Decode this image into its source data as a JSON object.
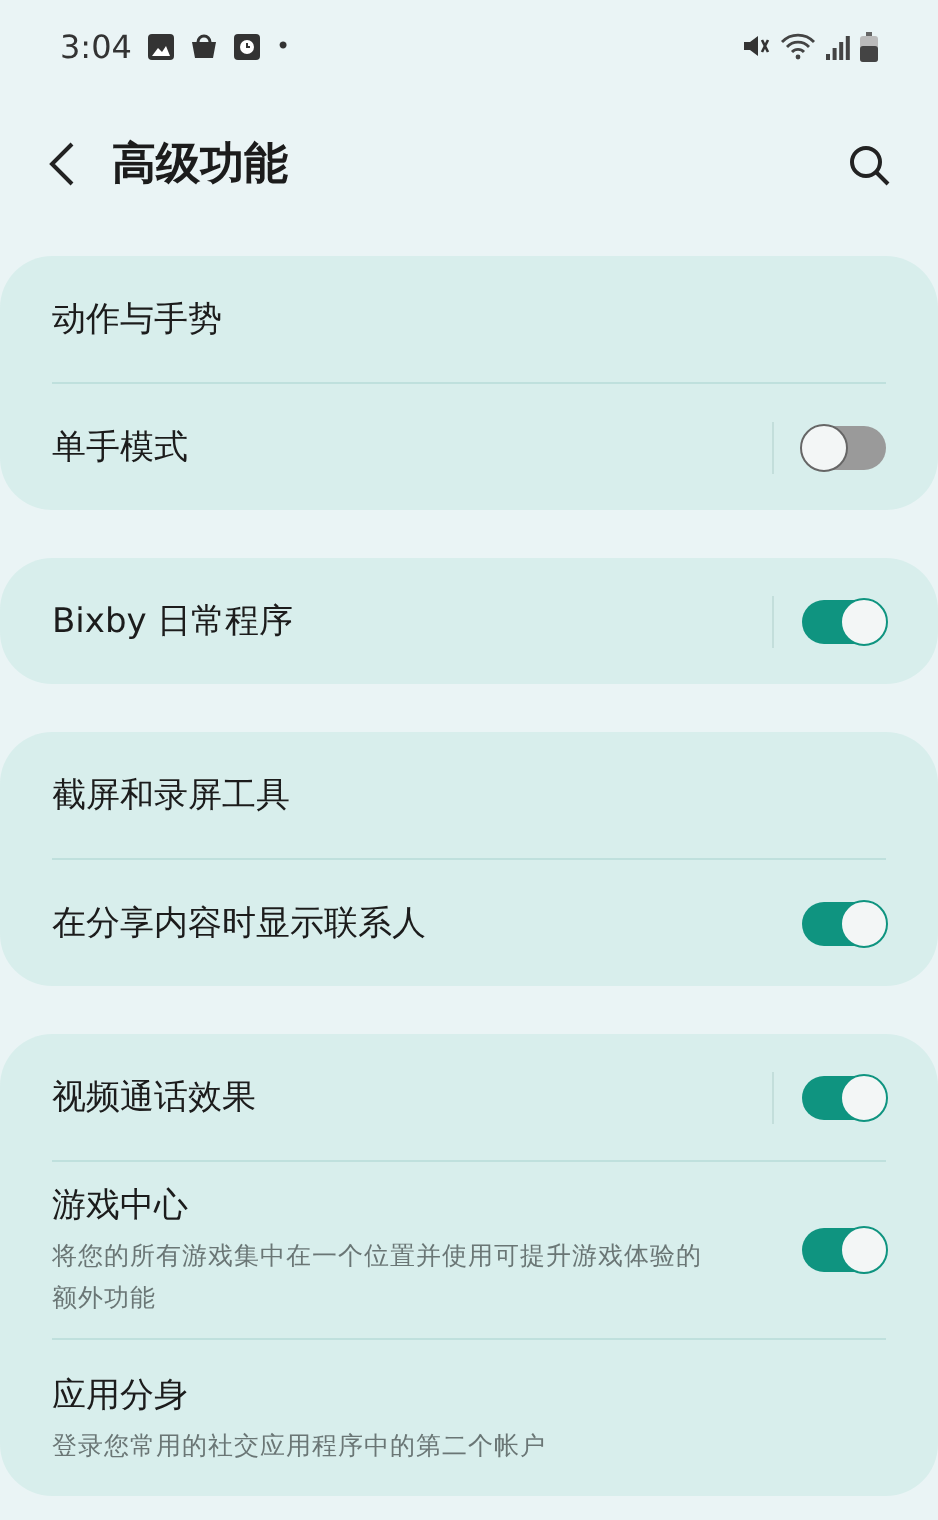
{
  "status_bar": {
    "time": "3:04",
    "dot": "•"
  },
  "header": {
    "title": "高级功能"
  },
  "groups": [
    {
      "items": [
        {
          "kind": "link",
          "title": "动作与手势"
        },
        {
          "kind": "switch",
          "title": "单手模式",
          "on": false,
          "split": true
        }
      ]
    },
    {
      "items": [
        {
          "kind": "switch",
          "title": "Bixby 日常程序",
          "on": true,
          "split": true
        }
      ]
    },
    {
      "items": [
        {
          "kind": "link",
          "title": "截屏和录屏工具"
        },
        {
          "kind": "switch",
          "title": "在分享内容时显示联系人",
          "on": true,
          "split": false
        }
      ]
    },
    {
      "items": [
        {
          "kind": "switch",
          "title": "视频通话效果",
          "on": true,
          "split": true
        },
        {
          "kind": "switch",
          "title": "游戏中心",
          "subtitle": "将您的所有游戏集中在一个位置并使用可提升游戏体验的额外功能",
          "on": true,
          "split": false
        },
        {
          "kind": "link",
          "title": "应用分身",
          "subtitle": "登录您常用的社交应用程序中的第二个帐户"
        }
      ]
    }
  ]
}
